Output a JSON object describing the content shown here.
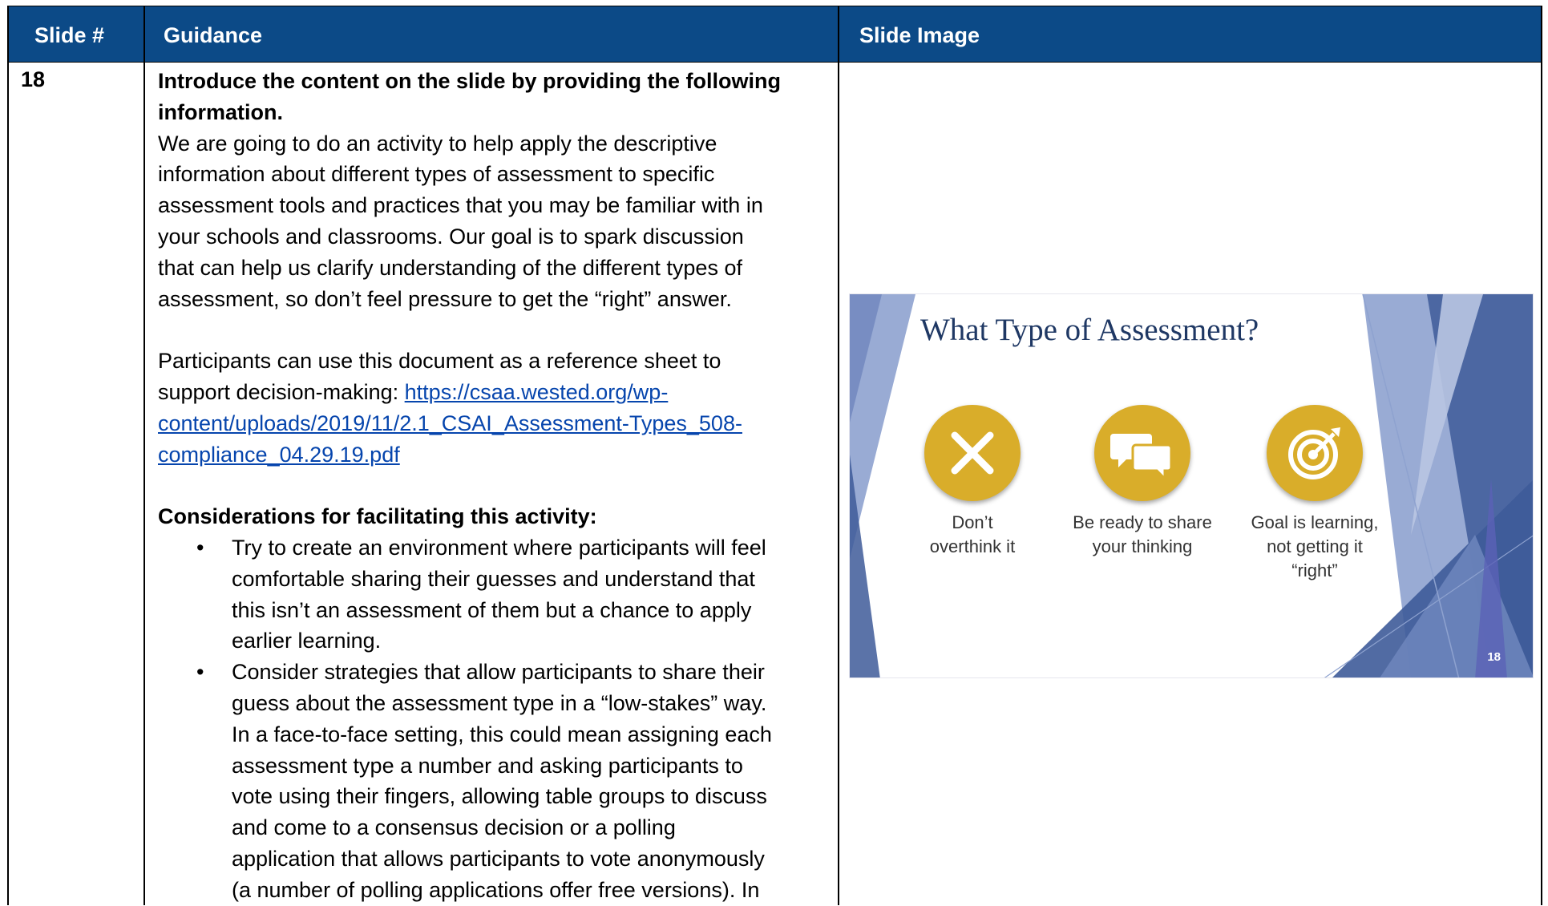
{
  "header": {
    "col1": "Slide #",
    "col2": "Guidance",
    "col3": "Slide Image"
  },
  "row": {
    "slide_number": "18",
    "intro_heading_line1": "Introduce the content on the slide by providing the following",
    "intro_heading_line2": "information.",
    "intro_lines": [
      "We are going to do an activity to help apply the descriptive",
      "information about different types of assessment to specific",
      "assessment tools and practices that you may be familiar with in",
      "your schools and classrooms. Our goal is to spark discussion",
      "that can help us clarify understanding of the different types of",
      "assessment, so don’t feel pressure to get the “right” answer."
    ],
    "ref_line1": "Participants can use this document as a reference sheet to",
    "ref_line2_prefix": "support decision-making: ",
    "link_line1": "https://csaa.wested.org/wp-",
    "link_line2": "content/uploads/2019/11/2.1_CSAI_Assessment-Types_508-",
    "link_line3": "compliance_04.29.19.pdf",
    "considerations_heading": "Considerations for facilitating this activity:",
    "bullet_char": "•",
    "bullet1_lines": [
      "Try to create an environment where participants will feel",
      "comfortable sharing their guesses and understand that",
      "this isn’t an assessment of them but a chance to apply",
      "earlier learning."
    ],
    "bullet2_lines": [
      "Consider strategies that allow participants to share their",
      "guess about the assessment type in a “low-stakes” way.",
      "In a face-to-face setting, this could mean assigning each",
      "assessment type a number and asking participants to",
      "vote using their fingers, allowing table groups to discuss",
      "and come to a consensus decision or a polling",
      "application that allows participants to vote anonymously",
      "(a number of polling applications offer free versions). In"
    ]
  },
  "slide": {
    "title": "What Type of Assessment?",
    "items": [
      {
        "icon": "x-icon",
        "caption_line1": "Don’t",
        "caption_line2": "overthink it",
        "caption_line3": ""
      },
      {
        "icon": "chat-bubbles-icon",
        "caption_line1": "Be ready to share",
        "caption_line2": "your thinking",
        "caption_line3": ""
      },
      {
        "icon": "target-icon",
        "caption_line1": "Goal is learning,",
        "caption_line2": "not getting it",
        "caption_line3": "“right”"
      }
    ],
    "page_number": "18",
    "colors": {
      "gold": "#d9ad2a",
      "title": "#1f3864",
      "shape_dark": "#3e5b99",
      "shape_light": "#8ea2cf"
    }
  },
  "colors": {
    "header_bg": "#0c4a87",
    "link": "#0645ad"
  }
}
